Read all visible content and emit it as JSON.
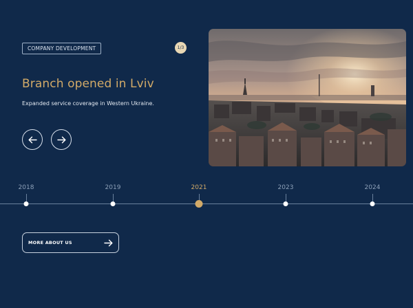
{
  "slide": {
    "tag": "COMPANY DEVELOPMENT",
    "counter": "1/3",
    "headline": "Branch opened in Lviv",
    "description": "Expanded service coverage in Western Ukraine."
  },
  "navigation": {
    "prev_icon": "arrow-left-icon",
    "next_icon": "arrow-right-icon"
  },
  "timeline": {
    "years": [
      "2018",
      "2019",
      "2021",
      "2023",
      "2024"
    ],
    "active_year": "2021"
  },
  "cta": {
    "label": "MORE ABOUT US",
    "icon": "arrow-right-icon"
  },
  "colors": {
    "background": "#10294a",
    "accent": "#d2aa68"
  }
}
